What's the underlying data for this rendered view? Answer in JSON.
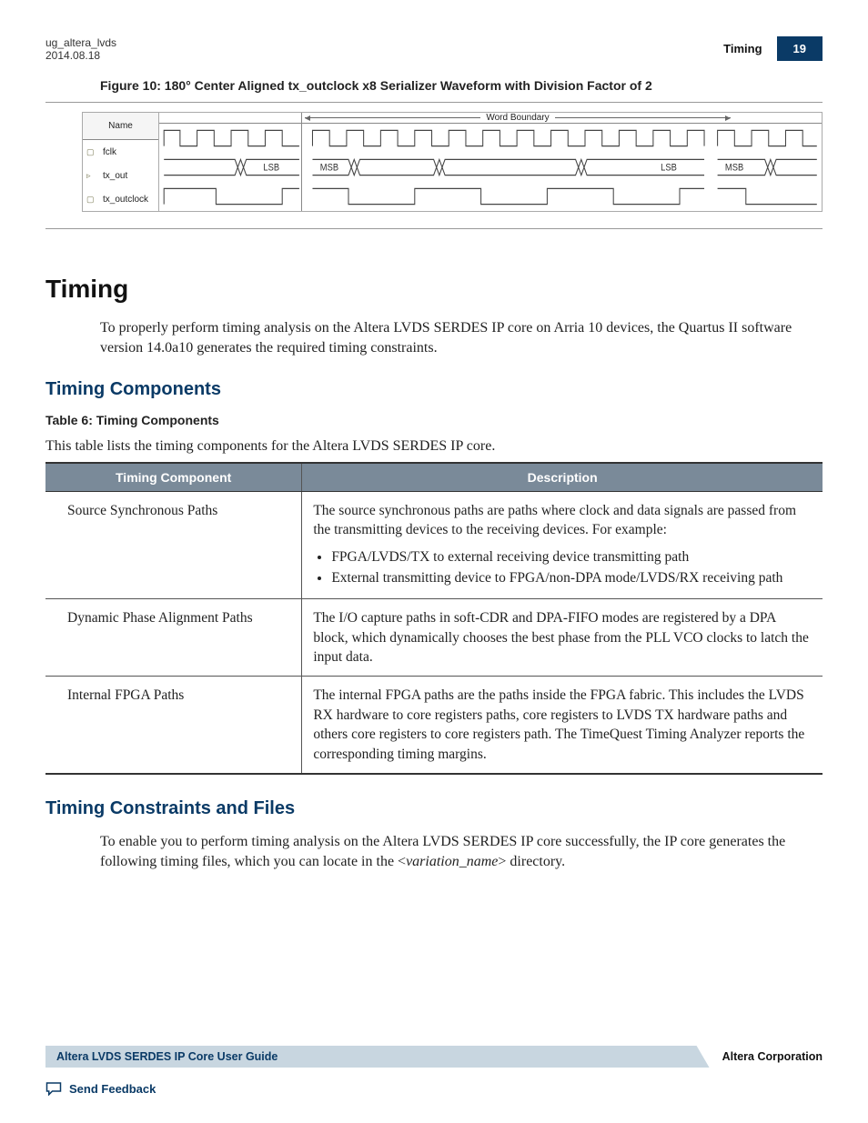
{
  "header": {
    "doc_id": "ug_altera_lvds",
    "date": "2014.08.18",
    "section_label": "Timing",
    "page_number": "19"
  },
  "figure": {
    "caption": "Figure 10: 180° Center Aligned tx_outclock x8 Serializer Waveform with Division Factor of 2",
    "name_header": "Name",
    "boundary_label": "Word Boundary",
    "signals": [
      "fclk",
      "tx_out",
      "tx_outclock"
    ],
    "markers": {
      "lsb": "LSB",
      "msb": "MSB"
    }
  },
  "timing": {
    "title": "Timing",
    "intro": "To properly perform timing analysis on the Altera LVDS SERDES IP core on Arria 10 devices, the Quartus II software version 14.0a10 generates the required timing constraints."
  },
  "components": {
    "heading": "Timing Components",
    "table_caption": "Table 6: Timing Components",
    "table_intro": "This table lists the timing components for the Altera LVDS SERDES IP core.",
    "col1": "Timing Component",
    "col2": "Description",
    "rows": [
      {
        "name": "Source Synchronous Paths",
        "para": "The source synchronous paths are paths where clock and data signals are passed from the transmitting devices to the receiving devices. For example:",
        "bullets": [
          "FPGA/LVDS/TX to external receiving device transmitting path",
          "External transmitting device to FPGA/non-DPA mode/LVDS/RX receiving path"
        ]
      },
      {
        "name": "Dynamic Phase Alignment Paths",
        "para": "The I/O capture paths in soft-CDR and DPA-FIFO modes are registered by a DPA block, which dynamically chooses the best phase from the PLL VCO clocks to latch the input data."
      },
      {
        "name": "Internal FPGA Paths",
        "para": "The internal FPGA paths are the paths inside the FPGA fabric. This includes the LVDS RX hardware to core registers paths, core registers to LVDS TX hardware paths and others core registers to core registers path. The TimeQuest Timing Analyzer reports the corresponding timing margins."
      }
    ]
  },
  "constraints": {
    "heading": "Timing Constraints and Files",
    "para_pre": "To enable you to perform timing analysis on the Altera LVDS SERDES IP core successfully, the IP core generates the following timing files, which you can locate in the <",
    "para_var": "variation_name",
    "para_post": "> directory."
  },
  "footer": {
    "guide_title": "Altera LVDS SERDES IP Core User Guide",
    "corp": "Altera Corporation",
    "feedback": "Send Feedback"
  }
}
